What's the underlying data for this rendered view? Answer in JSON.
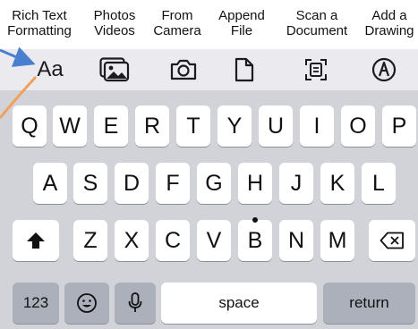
{
  "labels": [
    {
      "line1": "Rich Text",
      "line2": "Formatting"
    },
    {
      "line1": "Photos",
      "line2": "Videos"
    },
    {
      "line1": "From",
      "line2": "Camera"
    },
    {
      "line1": "Append",
      "line2": "File"
    },
    {
      "line1": "Scan a",
      "line2": "Document"
    },
    {
      "line1": "Add a",
      "line2": "Drawing"
    }
  ],
  "toolbar": {
    "format_text": "Aa",
    "icons": [
      "text-format-icon",
      "photo-icon",
      "camera-icon",
      "file-icon",
      "scan-document-icon",
      "drawing-icon"
    ]
  },
  "keyboard": {
    "row1": [
      "Q",
      "W",
      "E",
      "R",
      "T",
      "Y",
      "U",
      "I",
      "O",
      "P"
    ],
    "row2": [
      "A",
      "S",
      "D",
      "F",
      "G",
      "H",
      "J",
      "K",
      "L"
    ],
    "row3": [
      "Z",
      "X",
      "C",
      "V",
      "B",
      "N",
      "M"
    ],
    "numbers_label": "123",
    "space_label": "space",
    "return_label": "return"
  },
  "colors": {
    "arrow_blue": "#4a7fd0",
    "arrow_orange": "#f0a05a",
    "keyboard_bg": "#d1d3d9",
    "toolbar_bg": "#ebebef"
  }
}
